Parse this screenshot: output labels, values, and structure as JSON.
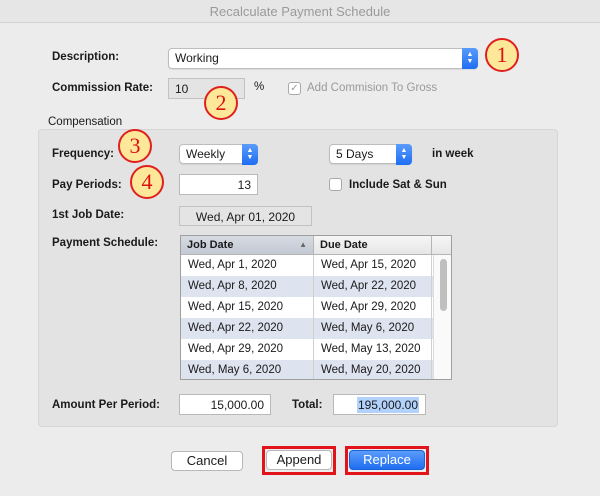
{
  "window": {
    "title": "Recalculate Payment Schedule"
  },
  "description": {
    "label": "Description:",
    "value": "Working"
  },
  "commission": {
    "label": "Commission Rate:",
    "value": "10",
    "unit": "%",
    "add_to_gross_label": "Add Commision To Gross",
    "add_to_gross_checked": true
  },
  "compensation": {
    "section_title": "Compensation",
    "frequency_label": "Frequency:",
    "frequency_value": "Weekly",
    "days_value": "5 Days",
    "days_suffix": "in week",
    "pay_periods_label": "Pay Periods:",
    "pay_periods_value": "13",
    "include_weekend_label": "Include Sat & Sun",
    "include_weekend_checked": false,
    "first_job_date_label": "1st Job Date:",
    "first_job_date_value": "Wed, Apr 01, 2020",
    "schedule_label": "Payment Schedule:",
    "schedule_columns": [
      "Job Date",
      "Due Date"
    ],
    "schedule_rows": [
      [
        "Wed, Apr 1, 2020",
        "Wed, Apr 15, 2020"
      ],
      [
        "Wed, Apr 8, 2020",
        "Wed, Apr 22, 2020"
      ],
      [
        "Wed, Apr 15, 2020",
        "Wed, Apr 29, 2020"
      ],
      [
        "Wed, Apr 22, 2020",
        "Wed, May 6, 2020"
      ],
      [
        "Wed, Apr 29, 2020",
        "Wed, May 13, 2020"
      ],
      [
        "Wed, May 6, 2020",
        "Wed, May 20, 2020"
      ]
    ],
    "amount_label": "Amount Per Period:",
    "amount_value": "15,000.00",
    "total_label": "Total:",
    "total_value": "195,000.00"
  },
  "buttons": {
    "cancel": "Cancel",
    "append": "Append",
    "replace": "Replace"
  },
  "callouts": [
    "1",
    "2",
    "3",
    "4"
  ],
  "colors": {
    "accent": "#1f6ef2",
    "callout_border": "#e0201c",
    "callout_fill": "#fde89a",
    "highlight_box": "#e0141a",
    "selection": "#b3d2fb"
  }
}
